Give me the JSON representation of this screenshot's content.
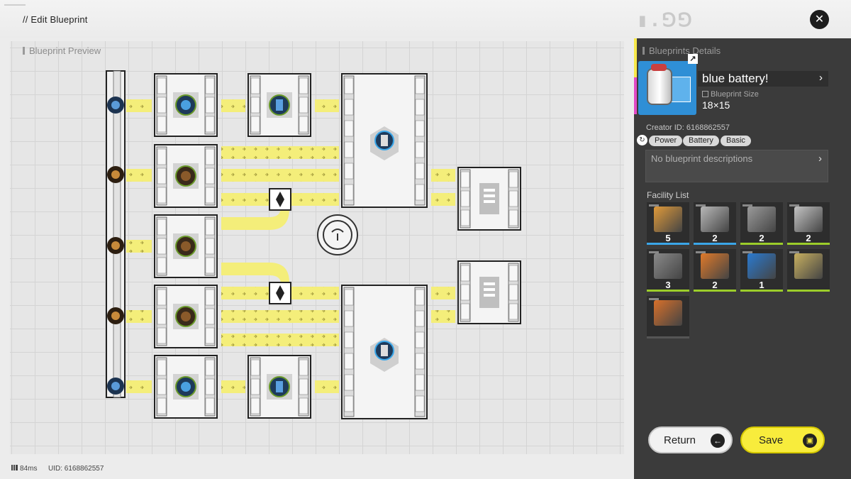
{
  "header": {
    "title": "// Edit Blueprint",
    "logo": "■.⃒ГГ"
  },
  "preview": {
    "label": "Blueprint Preview"
  },
  "details": {
    "title": "Blueprints Details",
    "name": "blue battery!",
    "size_label": "Blueprint Size",
    "size_value": "18×15",
    "creator": "Creator ID: 6168862557",
    "tags": [
      "Power",
      "Battery",
      "Basic"
    ],
    "description_placeholder": "No blueprint descriptions",
    "facility_title": "Facility List",
    "facilities": [
      {
        "icon": "refining-unit-icon",
        "count": "5",
        "color": "#e09a3a",
        "bar": "#3aa6e8"
      },
      {
        "icon": "crusher-unit-icon",
        "count": "2",
        "color": "#b8b8b8",
        "bar": "#3aa6e8"
      },
      {
        "icon": "moulding-unit-icon",
        "count": "2",
        "color": "#9a9a9a",
        "bar": "#9ccd2a"
      },
      {
        "icon": "fitting-unit-icon",
        "count": "2",
        "color": "#c4c4c4",
        "bar": "#9ccd2a"
      },
      {
        "icon": "packaging-unit-icon",
        "count": "3",
        "color": "#8a8a8a",
        "bar": "#9ccd2a"
      },
      {
        "icon": "filling-unit-icon",
        "count": "2",
        "color": "#e07a2a",
        "bar": "#9ccd2a"
      },
      {
        "icon": "relay-tower-icon",
        "count": "1",
        "color": "#2a7ad0",
        "bar": "#9ccd2a"
      },
      {
        "icon": "splitter-icon",
        "count": "",
        "color": "#c8b060",
        "bar": "#9ccd2a"
      },
      {
        "icon": "floor-plate-icon",
        "count": "",
        "color": "#d8702a",
        "bar": "#555555"
      }
    ]
  },
  "actions": {
    "return_label": "Return",
    "save_label": "Save"
  },
  "status": {
    "ping": "84ms",
    "uid": "UID: 6168862557"
  },
  "colors": {
    "accent_yellow": "#f8ec3c",
    "belt_yellow": "#f4ee7a",
    "panel_bg": "#3b3b3b"
  }
}
